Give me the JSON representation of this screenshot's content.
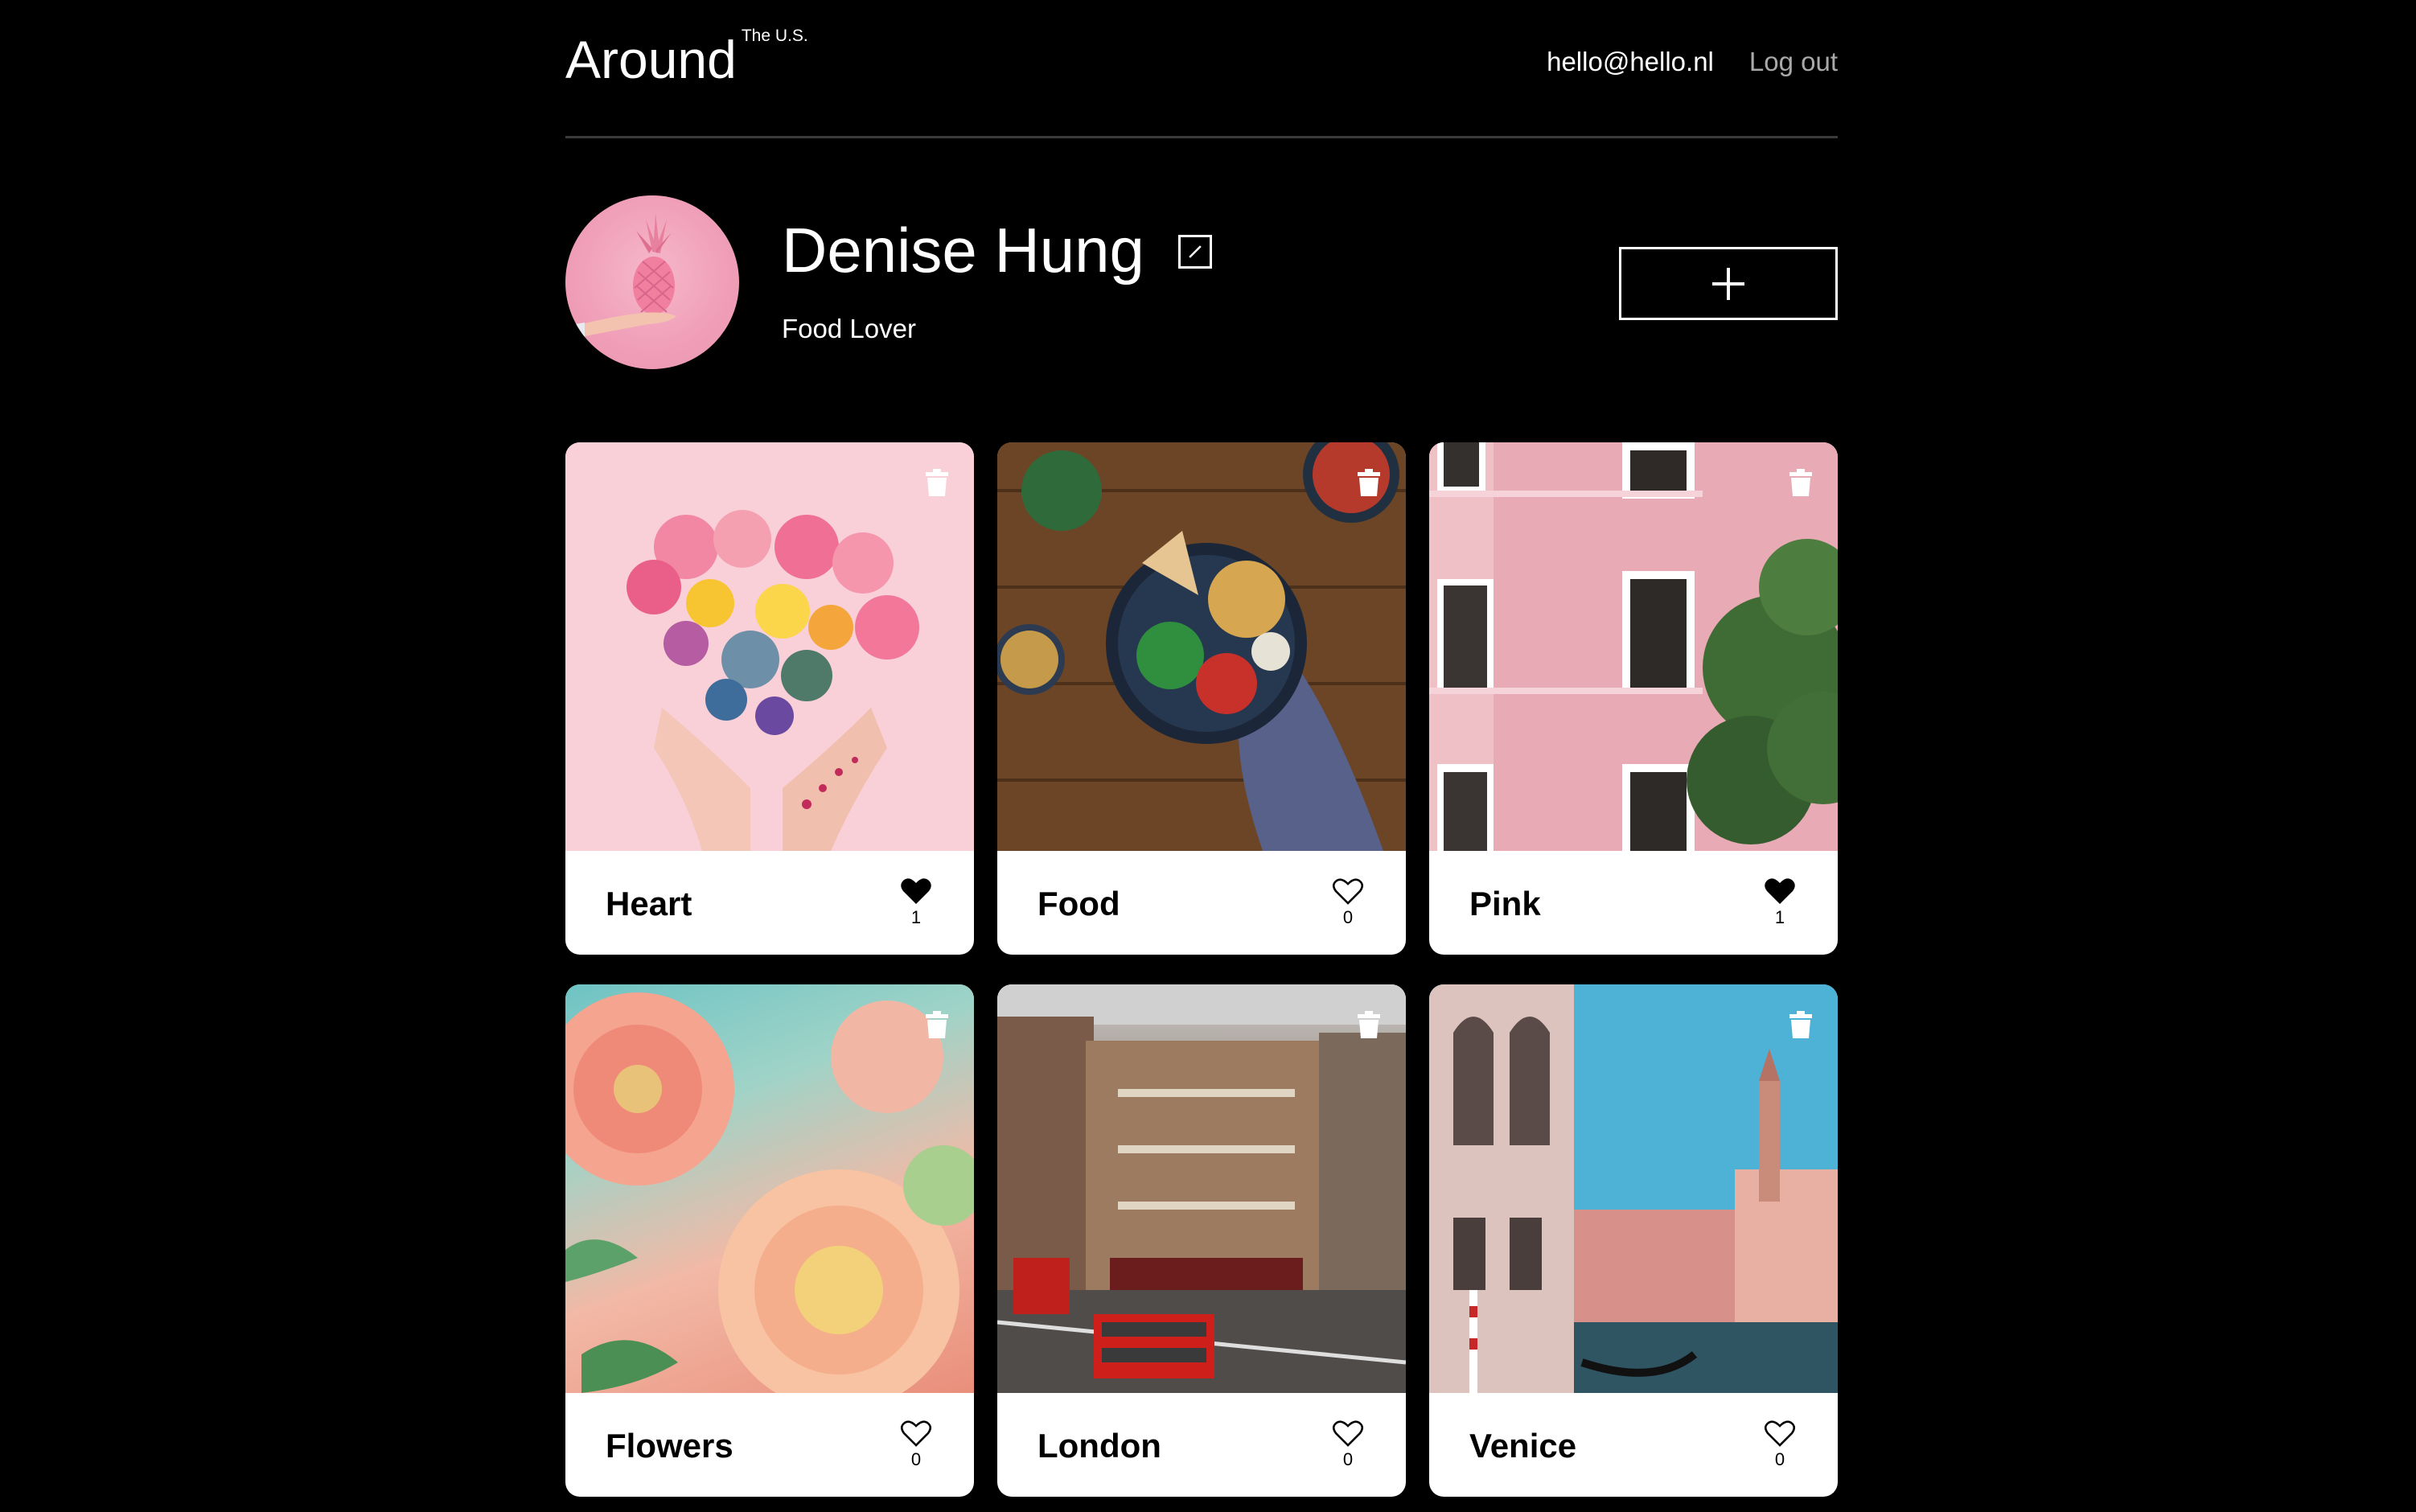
{
  "header": {
    "logo": "Around",
    "logo_sub": "The U.S.",
    "email": "hello@hello.nl",
    "logout_label": "Log out"
  },
  "profile": {
    "name": "Denise Hung",
    "about": "Food Lover",
    "edit_icon": "pencil-square-icon",
    "add_icon": "plus-icon"
  },
  "cards": [
    {
      "title": "Heart",
      "likes": "1",
      "liked": true
    },
    {
      "title": "Food",
      "likes": "0",
      "liked": false
    },
    {
      "title": "Pink",
      "likes": "1",
      "liked": true
    },
    {
      "title": "Flowers",
      "likes": "0",
      "liked": false
    },
    {
      "title": "London",
      "likes": "0",
      "liked": false
    },
    {
      "title": "Venice",
      "likes": "0",
      "liked": false
    }
  ],
  "colors": {
    "background": "#000000",
    "card": "#ffffff",
    "muted_text": "#a9a9a9",
    "divider": "#3a3a3a"
  }
}
